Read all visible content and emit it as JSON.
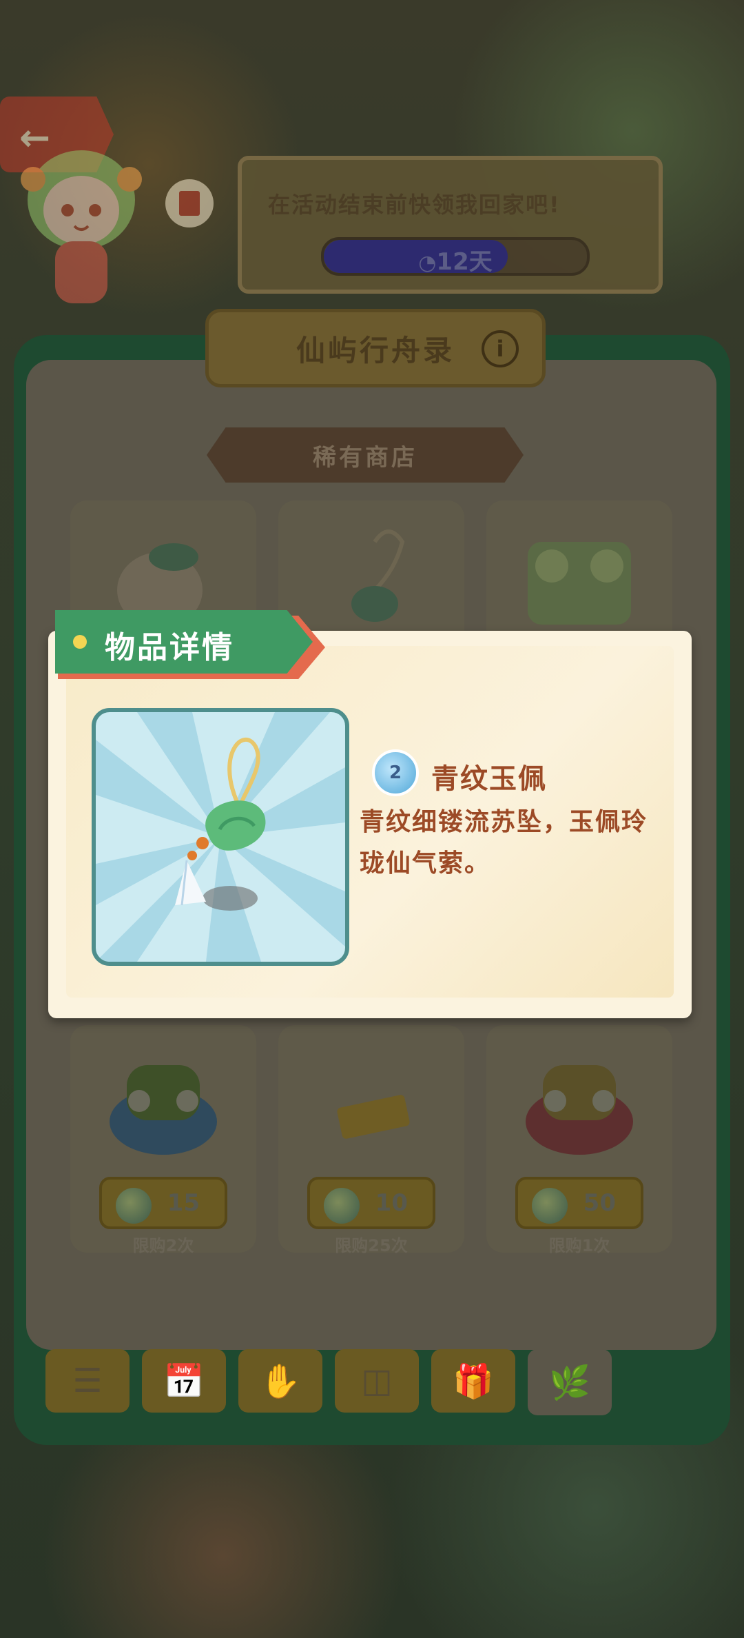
{
  "banner": {
    "message": "在活动结束前快领我回家吧!",
    "countdown": "12天",
    "countdown_fraction": 0.7
  },
  "panel": {
    "title": "仙屿行舟录",
    "section": "稀有商店"
  },
  "shop_items": [
    {
      "price": "15",
      "limit": "限购2次"
    },
    {
      "price": "10",
      "limit": "限购25次"
    },
    {
      "price": "50",
      "limit": "限购1次"
    }
  ],
  "modal": {
    "header": "物品详情",
    "rarity": "2",
    "item_name": "青纹玉佩",
    "item_description": "青纹细镂流苏坠，玉佩玲珑仙气萦。"
  },
  "tabs": [
    "list-icon",
    "calendar-icon",
    "hand-icon",
    "cards-icon",
    "gift-icon",
    "leaf-icon"
  ],
  "colors": {
    "panel_green": "#1e4a30",
    "header_green": "#3f9a63",
    "accent_red": "#e46a4d",
    "text_brown": "#9c4a26"
  }
}
